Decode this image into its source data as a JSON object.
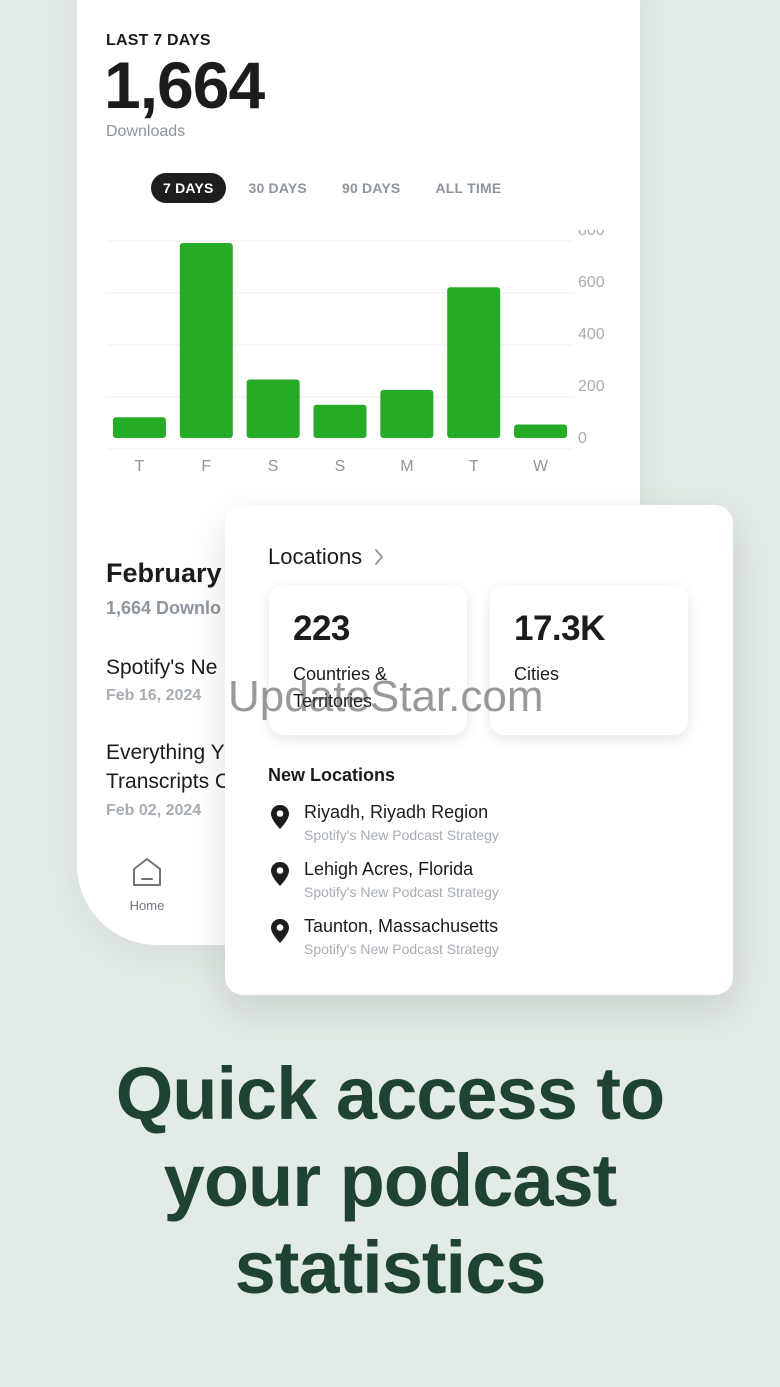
{
  "stats_panel": {
    "period_label": "LAST 7 DAYS",
    "total": "1,664",
    "total_label": "Downloads",
    "ranges": [
      "7 DAYS",
      "30 DAYS",
      "90 DAYS",
      "ALL TIME"
    ],
    "active_range": "7 DAYS"
  },
  "chart_data": {
    "type": "bar",
    "categories": [
      "T",
      "F",
      "S",
      "S",
      "M",
      "T",
      "W"
    ],
    "values": [
      80,
      750,
      225,
      128,
      185,
      580,
      52
    ],
    "ylim": [
      0,
      800
    ],
    "yticks": [
      "800",
      "600",
      "400",
      "200",
      "0"
    ],
    "bar_color": "#26ab26",
    "grid": true,
    "y_axis_side": "right"
  },
  "episodes_section": {
    "month": "February",
    "month_downloads": "1,664 Downlo",
    "episodes": [
      {
        "title": "Spotify's Ne",
        "date": "Feb 16, 2024"
      },
      {
        "title": "Everything Y",
        "title2": "Transcripts C",
        "date": "Feb 02, 2024"
      }
    ]
  },
  "tab_bar": {
    "home_label": "Home"
  },
  "locations_card": {
    "title": "Locations",
    "countries_count": "223",
    "countries_label": "Countries & Territories",
    "cities_count": "17.3K",
    "cities_label": "Cities",
    "new_locations_title": "New Locations",
    "new_locations": [
      {
        "place": "Riyadh, Riyadh Region",
        "show": "Spotify's New Podcast Strategy"
      },
      {
        "place": "Lehigh Acres, Florida",
        "show": "Spotify's New Podcast Strategy"
      },
      {
        "place": "Taunton, Massachusetts",
        "show": "Spotify's New Podcast Strategy"
      }
    ]
  },
  "watermark": "UpdateStar.com",
  "headline": [
    "Quick access to",
    "your podcast",
    "statistics"
  ],
  "colors": {
    "background": "#e3ebe6",
    "accent_green": "#26ab26",
    "headline": "#1f4332"
  }
}
